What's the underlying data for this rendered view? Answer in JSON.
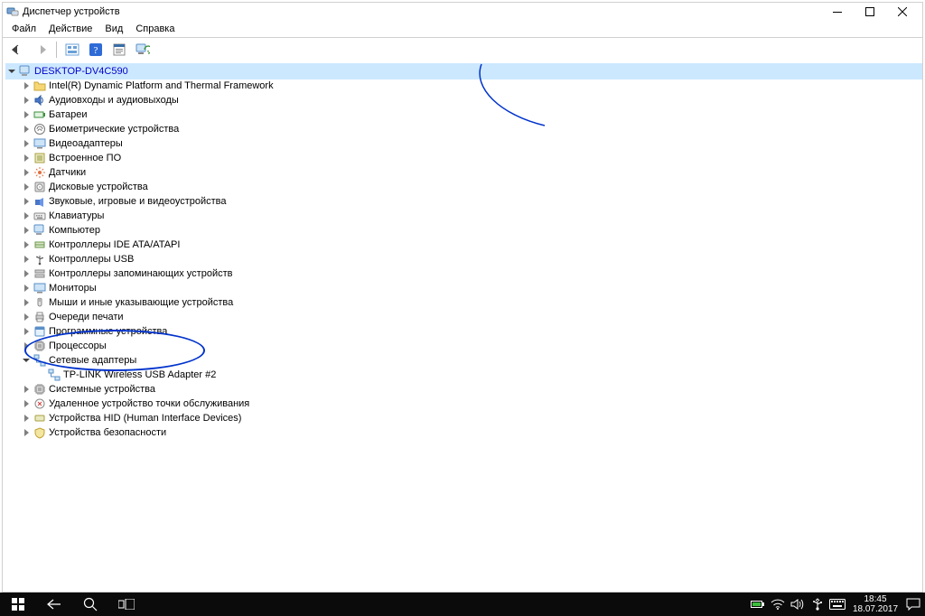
{
  "window": {
    "title": "Диспетчер устройств"
  },
  "menubar": {
    "file": "Файл",
    "action": "Действие",
    "view": "Вид",
    "help": "Справка"
  },
  "tree": {
    "root": "DESKTOP-DV4C590",
    "items": [
      {
        "label": "Intel(R) Dynamic Platform and Thermal Framework",
        "icon": "folder"
      },
      {
        "label": "Аудиовходы и аудиовыходы",
        "icon": "audio"
      },
      {
        "label": "Батареи",
        "icon": "battery"
      },
      {
        "label": "Биометрические устройства",
        "icon": "biometric"
      },
      {
        "label": "Видеоадаптеры",
        "icon": "display"
      },
      {
        "label": "Встроенное ПО",
        "icon": "firmware"
      },
      {
        "label": "Датчики",
        "icon": "sensor"
      },
      {
        "label": "Дисковые устройства",
        "icon": "disk"
      },
      {
        "label": "Звуковые, игровые и видеоустройства",
        "icon": "media"
      },
      {
        "label": "Клавиатуры",
        "icon": "keyboard"
      },
      {
        "label": "Компьютер",
        "icon": "computer"
      },
      {
        "label": "Контроллеры IDE ATA/ATAPI",
        "icon": "ide"
      },
      {
        "label": "Контроллеры USB",
        "icon": "usb"
      },
      {
        "label": "Контроллеры запоминающих устройств",
        "icon": "storage"
      },
      {
        "label": "Мониторы",
        "icon": "monitor"
      },
      {
        "label": "Мыши и иные указывающие устройства",
        "icon": "mouse"
      },
      {
        "label": "Очереди печати",
        "icon": "print"
      },
      {
        "label": "Программные устройства",
        "icon": "software"
      },
      {
        "label": "Процессоры",
        "icon": "cpu"
      },
      {
        "label": "Сетевые адаптеры",
        "icon": "network",
        "expanded": true,
        "children": [
          {
            "label": "TP-LINK Wireless USB Adapter #2",
            "icon": "network"
          }
        ]
      },
      {
        "label": "Системные устройства",
        "icon": "system"
      },
      {
        "label": "Удаленное устройство точки обслуживания",
        "icon": "pos"
      },
      {
        "label": "Устройства HID (Human Interface Devices)",
        "icon": "hid"
      },
      {
        "label": "Устройства безопасности",
        "icon": "security"
      }
    ]
  },
  "taskbar": {
    "time": "18:45",
    "date": "18.07.2017"
  }
}
